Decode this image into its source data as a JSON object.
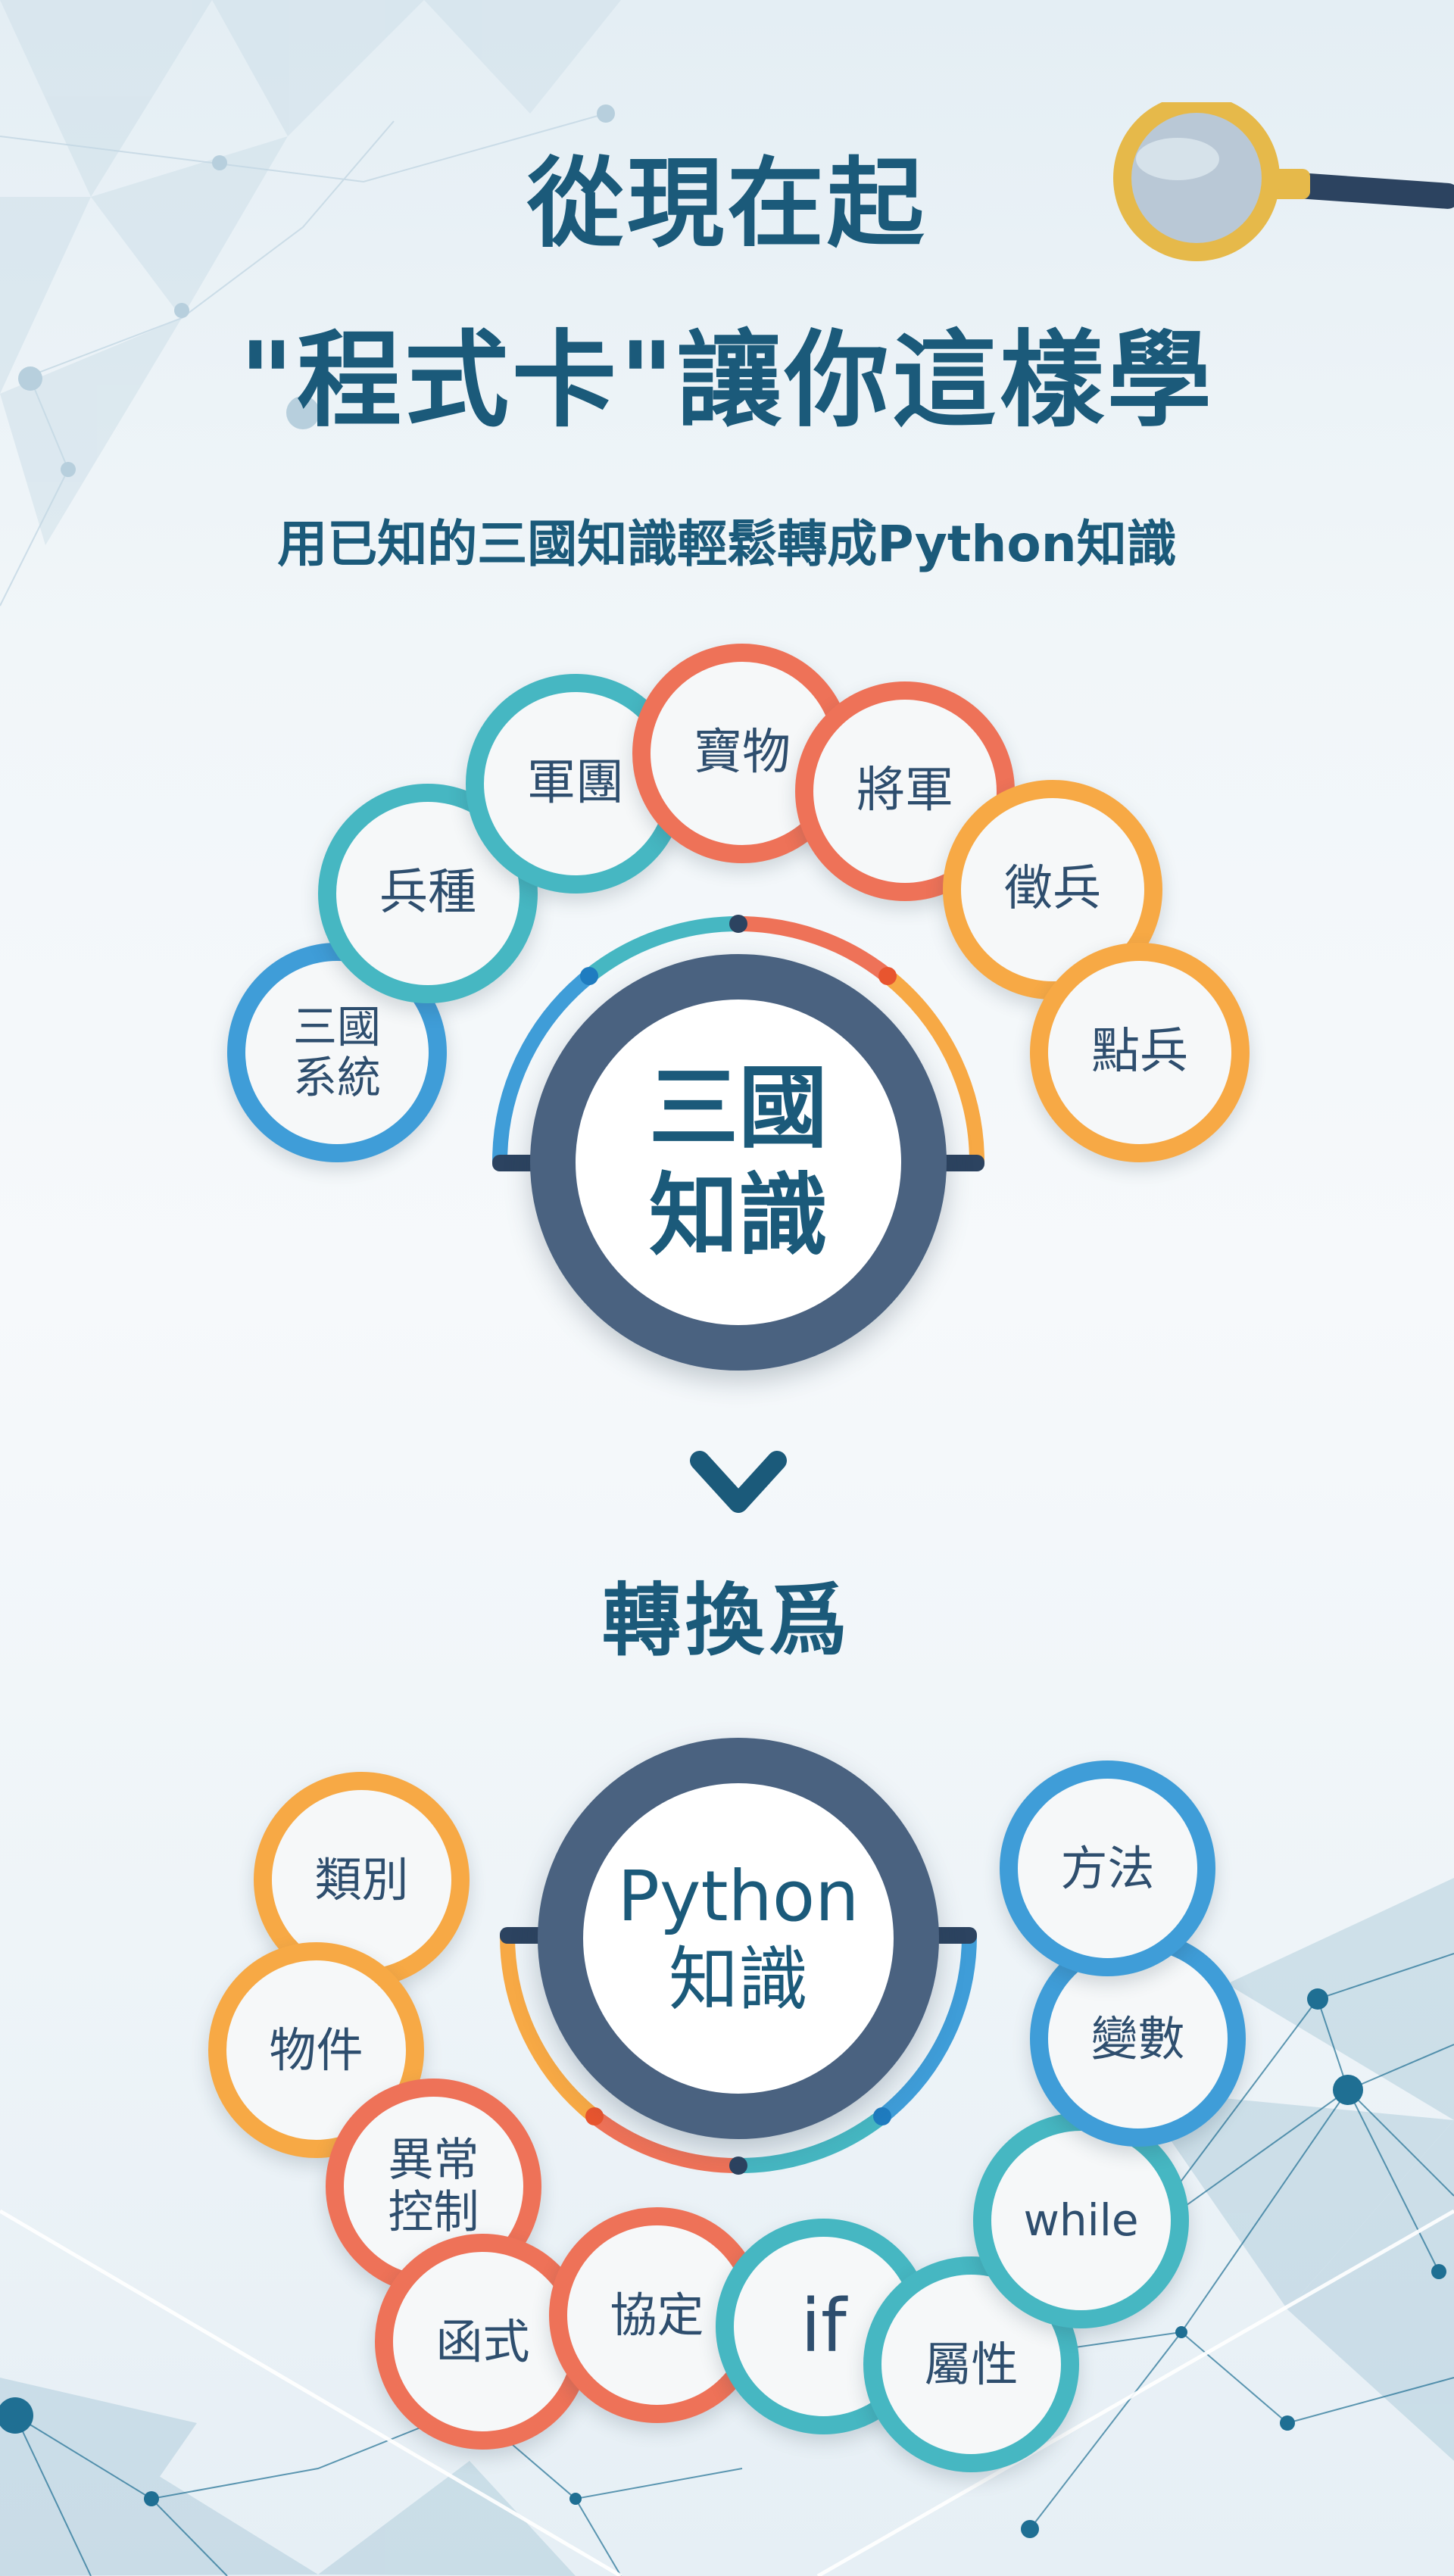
{
  "title": {
    "line1": "從現在起",
    "line2": "\"程式卡\"讓你這樣學",
    "subtitle": "用已知的三國知識輕鬆轉成Python知識"
  },
  "top_hub": {
    "center": "三國\n知識",
    "items": [
      {
        "label": "三國\n系統",
        "color": "#3f9dd8"
      },
      {
        "label": "兵種",
        "color": "#46b7c2"
      },
      {
        "label": "軍團",
        "color": "#46b7c2"
      },
      {
        "label": "寶物",
        "color": "#ee7258"
      },
      {
        "label": "將軍",
        "color": "#ee7258"
      },
      {
        "label": "徵兵",
        "color": "#f7a945"
      },
      {
        "label": "點兵",
        "color": "#f7a945"
      }
    ]
  },
  "transition": {
    "arrow_icon": "chevron-down-icon",
    "label": "轉換爲"
  },
  "bottom_hub": {
    "center": "Python\n知識",
    "items": [
      {
        "label": "類別",
        "color": "#f7a945"
      },
      {
        "label": "物件",
        "color": "#f7a945"
      },
      {
        "label": "異常\n控制",
        "color": "#ee7258"
      },
      {
        "label": "函式",
        "color": "#ee7258"
      },
      {
        "label": "協定",
        "color": "#ee7258"
      },
      {
        "label": "if",
        "color": "#46b7c2"
      },
      {
        "label": "屬性",
        "color": "#46b7c2"
      },
      {
        "label": "while",
        "color": "#46b7c2"
      },
      {
        "label": "變數",
        "color": "#3f9dd8"
      },
      {
        "label": "方法",
        "color": "#3f9dd8"
      }
    ]
  },
  "colors": {
    "title": "#1b5a7a",
    "hub_dark": "#4a6280",
    "orange": "#f7a945",
    "red": "#ee7258",
    "teal": "#46b7c2",
    "blue": "#3f9dd8"
  }
}
